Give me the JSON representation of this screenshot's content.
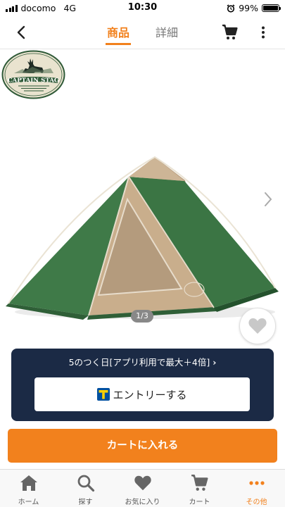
{
  "status_bar": {
    "carrier": "docomo",
    "network": "4G",
    "time": "10:30",
    "battery_percent": "99%",
    "battery_level": 0.99
  },
  "nav": {
    "tab_product": "商品",
    "tab_detail": "詳細",
    "back_icon": "chevron-left-icon",
    "cart_icon": "cart-icon",
    "more_icon": "more-vertical-icon"
  },
  "gallery": {
    "brand_logo_text": "CAPTAIN STAG",
    "page_indicator": "1/3"
  },
  "campaign": {
    "text": "5のつく日[アプリ利用で最大＋4倍]",
    "entry_label": "エントリーする"
  },
  "cart_button_label": "カートに入れる",
  "tabbar": {
    "items": [
      {
        "label": "ホーム",
        "icon": "home-icon"
      },
      {
        "label": "探す",
        "icon": "search-icon"
      },
      {
        "label": "お気に入り",
        "icon": "heart-icon"
      },
      {
        "label": "カート",
        "icon": "cart-icon"
      },
      {
        "label": "その他",
        "icon": "more-horizontal-icon"
      }
    ]
  },
  "colors": {
    "accent": "#f2811d",
    "campaign_bg": "#1b2a45",
    "tent_green": "#3f7a48",
    "tent_beige": "#c9ae8c"
  }
}
